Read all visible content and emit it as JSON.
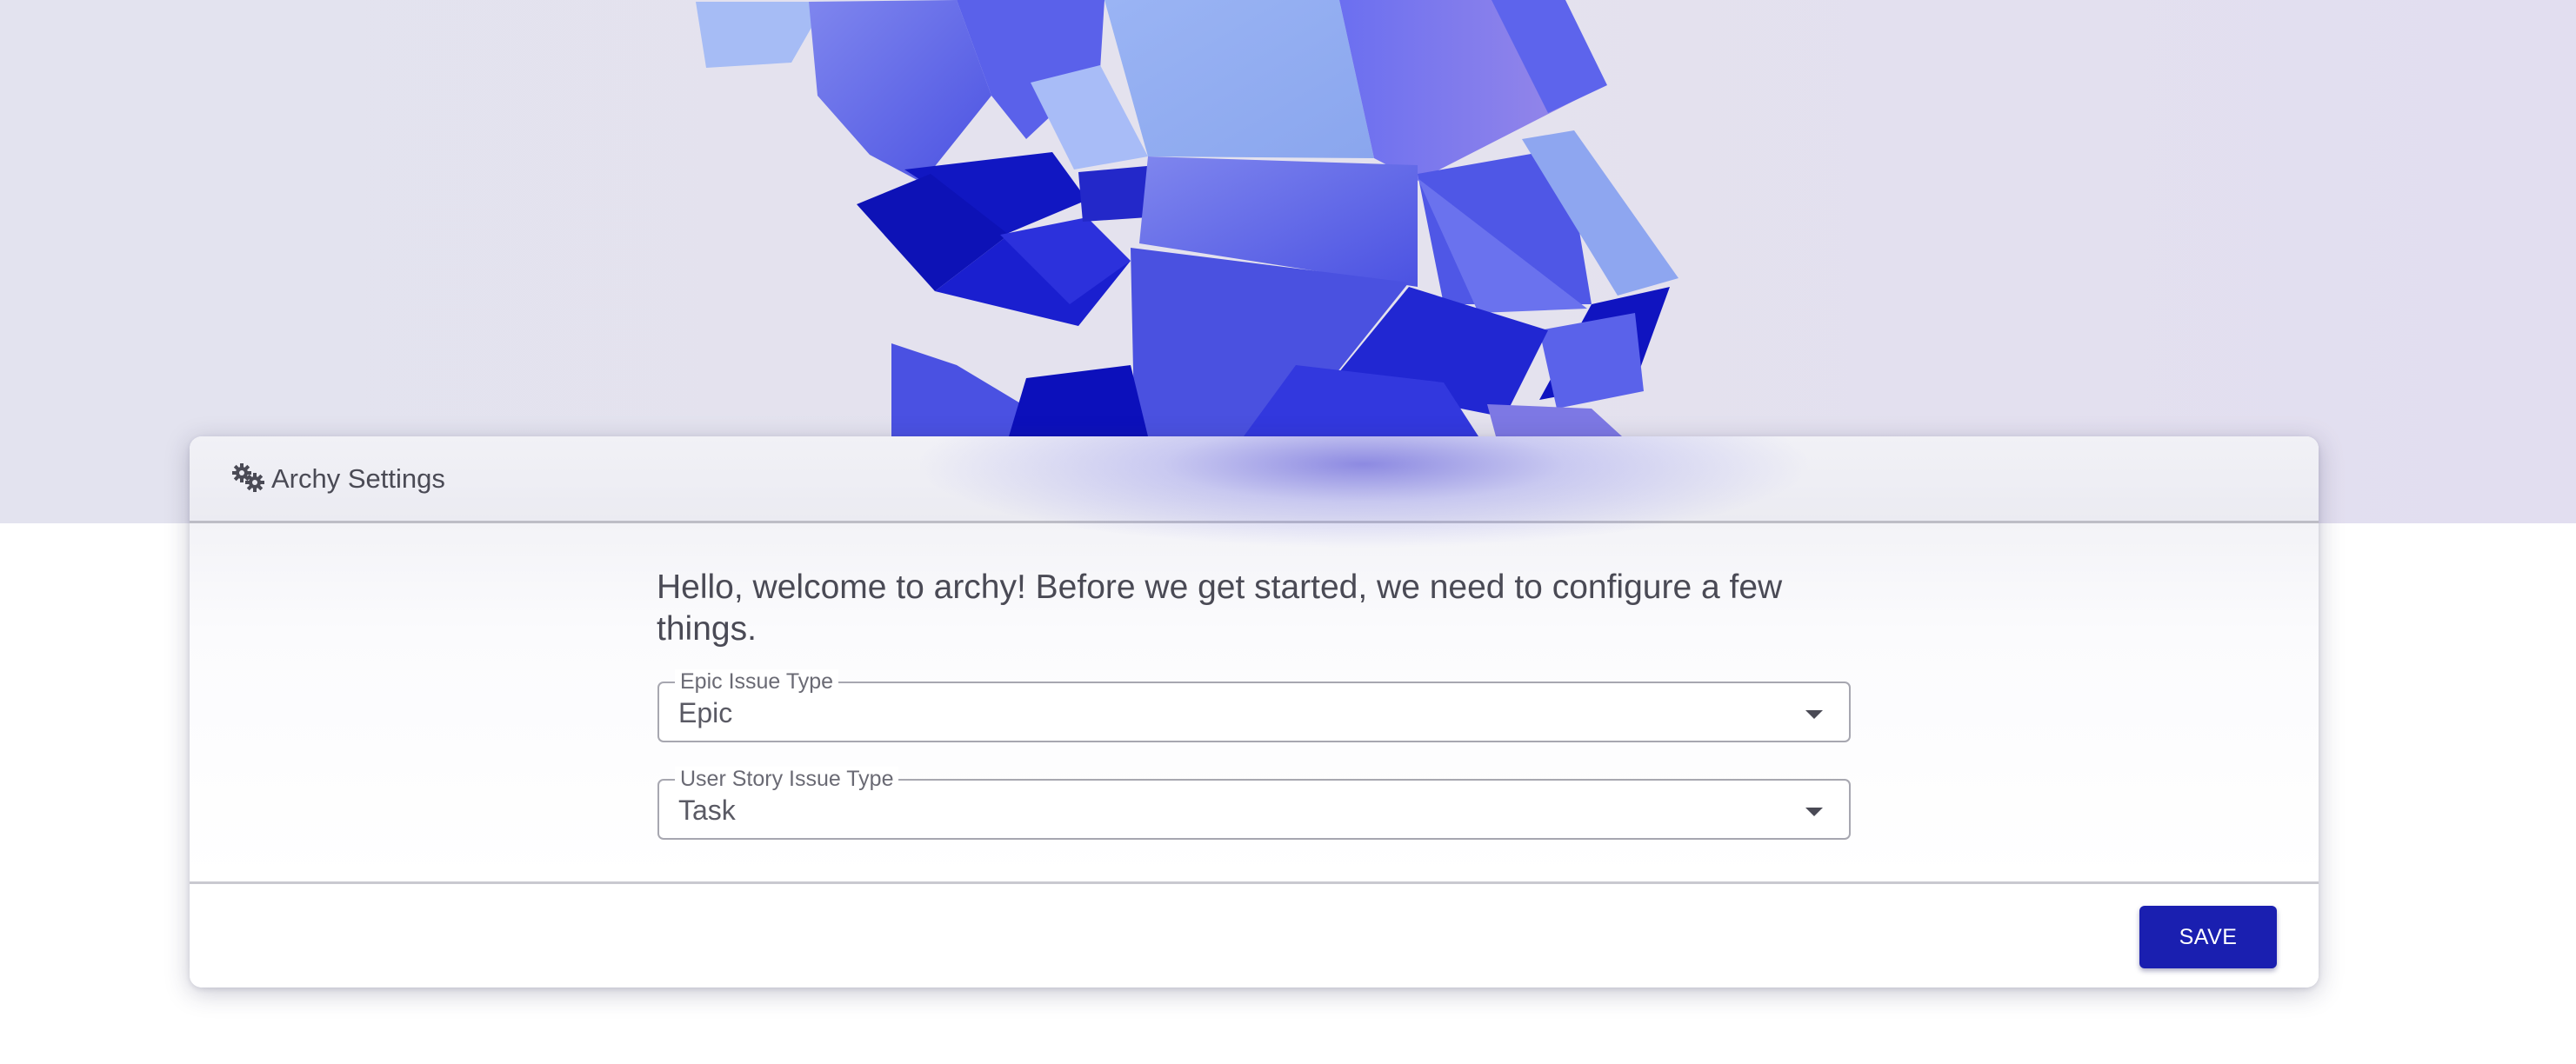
{
  "hero": {
    "image": "abstract-blue-cubes-illustration"
  },
  "header": {
    "icon": "gears-icon",
    "title": "Archy Settings"
  },
  "main": {
    "welcome_text": "Hello, welcome to archy! Before we get started, we need to configure a few things.",
    "fields": [
      {
        "label": "Epic Issue Type",
        "value": "Epic",
        "icon": "caret-down-icon"
      },
      {
        "label": "User Story Issue Type",
        "value": "Task",
        "icon": "caret-down-icon"
      }
    ]
  },
  "footer": {
    "save_label": "SAVE"
  },
  "colors": {
    "accent": "#1a1fb0",
    "text": "#4a4a55",
    "hero_bg": "#e3e3ef"
  }
}
